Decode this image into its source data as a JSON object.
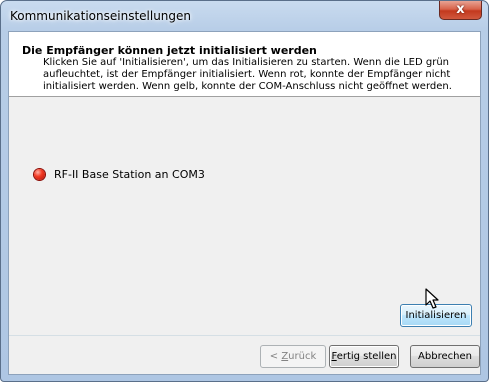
{
  "window": {
    "title": "Kommunikationseinstellungen",
    "close_glyph": "x"
  },
  "header": {
    "title": "Die Empfänger können jetzt initialisiert werden",
    "description": "Klicken Sie auf 'Initialisieren', um das Initialisieren zu starten. Wenn die LED grün aufleuchtet, ist der Empfänger initialisiert. Wenn rot, konnte der Empfänger nicht initialisiert werden. Wenn gelb, konnte der COM-Anschluss nicht geöffnet werden."
  },
  "devices": [
    {
      "label": "RF-II Base Station an COM3",
      "led_status": "red",
      "led_color": "#e8301c"
    }
  ],
  "buttons": {
    "initialize": "Initialisieren",
    "back": "< Zurück",
    "back_accel": "Z",
    "back_rest": "urück",
    "back_prefix": "< ",
    "finish_accel": "F",
    "finish_rest": "ertig stellen",
    "cancel": "Abbrechen"
  },
  "cursor": {
    "icon": "mouse-pointer-icon"
  }
}
